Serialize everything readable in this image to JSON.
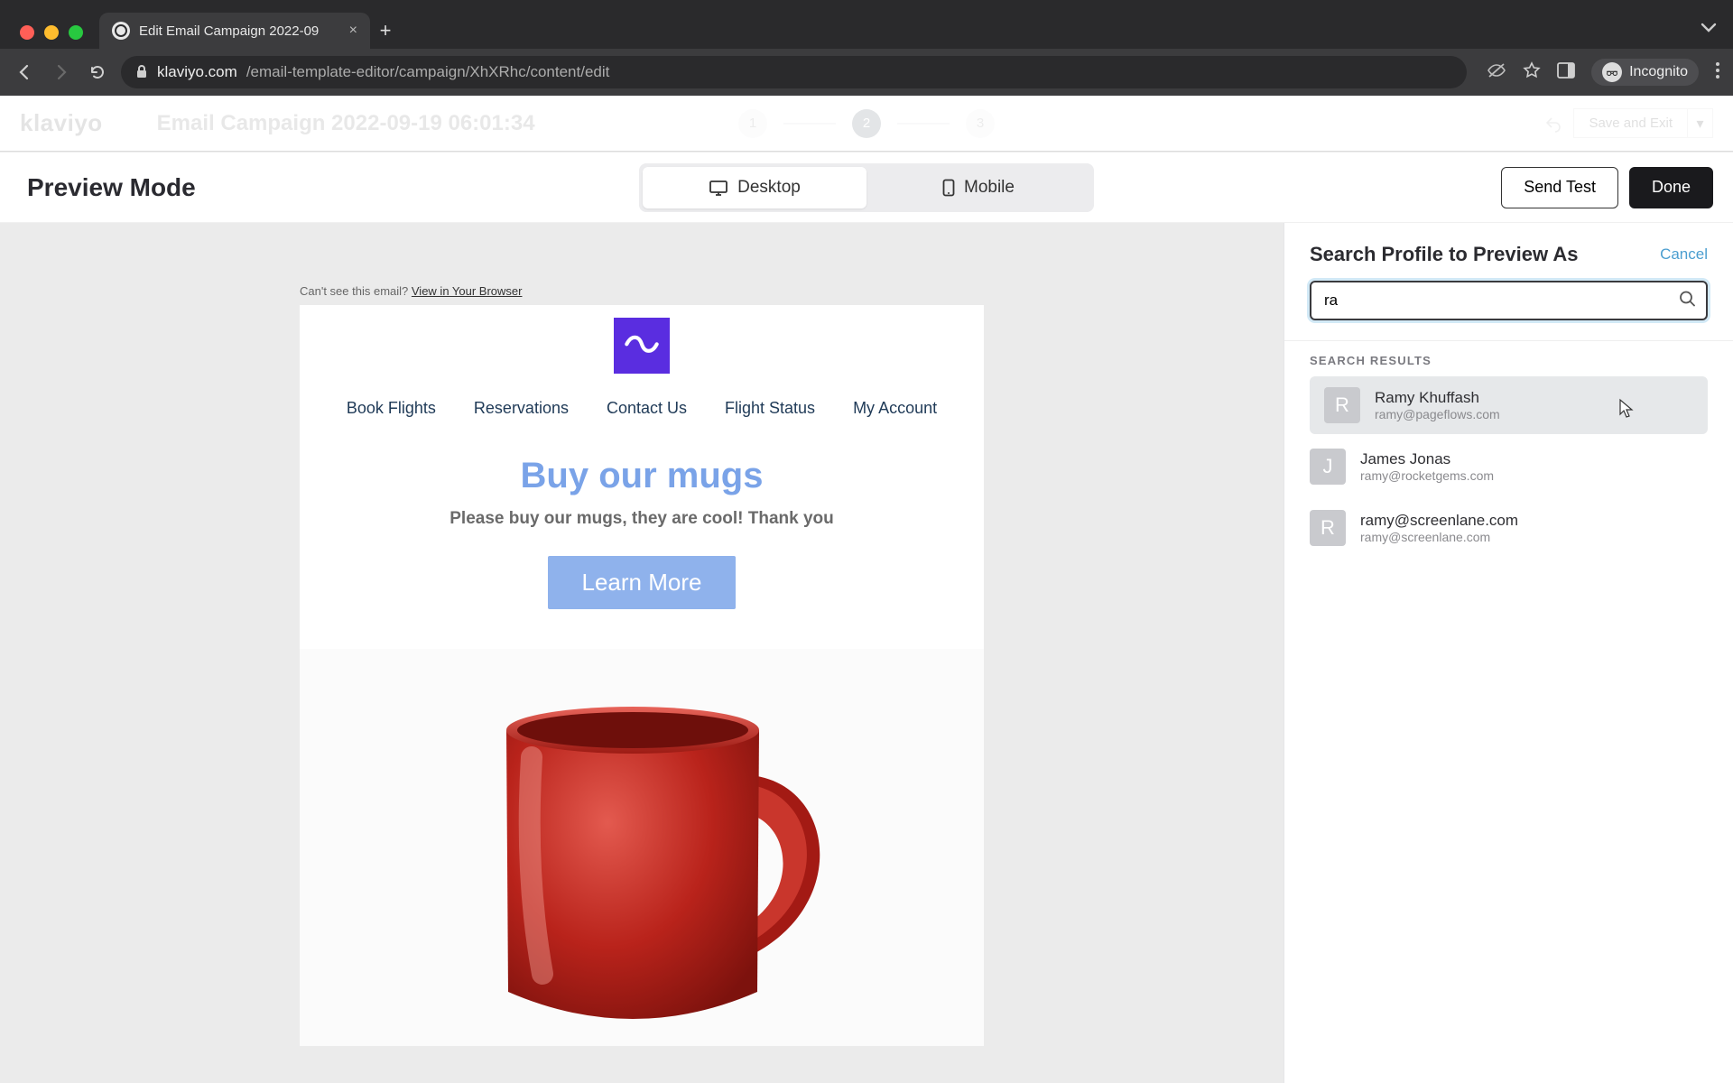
{
  "browser": {
    "tab_title": "Edit Email Campaign 2022-09",
    "url_domain": "klaviyo.com",
    "url_path": "/email-template-editor/campaign/XhXRhc/content/edit",
    "mode_label": "Incognito"
  },
  "app_header": {
    "logo_text": "klaviyo",
    "campaign_name": "Email Campaign 2022-09-19 06:01:34",
    "steps": [
      "1",
      "2",
      "3"
    ],
    "save_exit_label": "Save and Exit"
  },
  "modal": {
    "title": "Preview Mode",
    "toggle": {
      "desktop": "Desktop",
      "mobile": "Mobile"
    },
    "send_test": "Send Test",
    "done": "Done"
  },
  "email": {
    "view_browser_pre": "Can't see this email? ",
    "view_browser_link": "View in Your Browser",
    "nav": [
      "Book Flights",
      "Reservations",
      "Contact Us",
      "Flight Status",
      "My Account"
    ],
    "headline": "Buy our mugs",
    "subhead": "Please buy our mugs, they are cool! Thank you",
    "cta": "Learn More"
  },
  "panel": {
    "title": "Search Profile to Preview As",
    "cancel": "Cancel",
    "search_value": "ra",
    "results_label": "SEARCH RESULTS",
    "results": [
      {
        "initial": "R",
        "name": "Ramy Khuffash",
        "email": "ramy@pageflows.com"
      },
      {
        "initial": "J",
        "name": "James Jonas",
        "email": "ramy@rocketgems.com"
      },
      {
        "initial": "R",
        "name": "ramy@screenlane.com",
        "email": "ramy@screenlane.com"
      }
    ]
  }
}
